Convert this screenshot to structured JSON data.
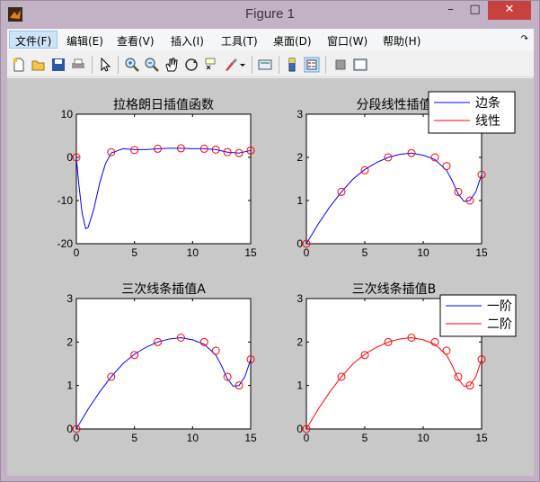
{
  "window": {
    "title": "Figure 1"
  },
  "menu": {
    "items": [
      {
        "label": "文件(F)",
        "active": true
      },
      {
        "label": "编辑(E)"
      },
      {
        "label": "查看(V)"
      },
      {
        "label": "插入(I)"
      },
      {
        "label": "工具(T)"
      },
      {
        "label": "桌面(D)"
      },
      {
        "label": "窗口(W)"
      },
      {
        "label": "帮助(H)"
      }
    ],
    "overflow_icon": "chevron-icon"
  },
  "toolbar": {
    "icons": [
      "new-figure-icon",
      "open-file-icon",
      "save-icon",
      "print-icon",
      "select-arrow-icon",
      "zoom-in-icon",
      "zoom-out-icon",
      "pan-hand-icon",
      "rotate-3d-icon",
      "data-cursor-icon",
      "brush-icon",
      "brush-dropdown-icon",
      "link-plot-icon",
      "colorbar-icon",
      "legend-icon",
      "hide-plot-tools-icon",
      "show-plot-tools-icon"
    ]
  },
  "colors": {
    "blue": "#0000ff",
    "red": "#ff0000",
    "figure_bg": "#c8c8c8"
  },
  "chart_data": [
    {
      "type": "line",
      "title": "拉格朗日插值函数",
      "xlim": [
        0,
        15
      ],
      "ylim": [
        -20,
        10
      ],
      "xticks": [
        0,
        5,
        10,
        15
      ],
      "yticks": [
        -20,
        -10,
        0,
        10
      ],
      "series": [
        {
          "color": "blue",
          "x": [
            0,
            0.2,
            0.5,
            0.8,
            1.0,
            1.5,
            2.0,
            2.5,
            3,
            4,
            5,
            6,
            7,
            8,
            9,
            10,
            11,
            12,
            13,
            14,
            15
          ],
          "y": [
            0,
            -6,
            -13,
            -16.5,
            -16.3,
            -12,
            -6,
            -1.5,
            1,
            2,
            1.8,
            1.8,
            2,
            2.1,
            2.1,
            2,
            2,
            1.8,
            1.2,
            1,
            1.6
          ]
        },
        {
          "color": "red",
          "marker": "circle",
          "x": [
            0,
            3,
            5,
            7,
            9,
            11,
            12,
            13,
            14,
            15
          ],
          "y": [
            0,
            1.2,
            1.7,
            2.0,
            2.1,
            2.0,
            1.8,
            1.2,
            1.0,
            1.6
          ]
        }
      ]
    },
    {
      "type": "line",
      "title": "分段线性插值",
      "xlim": [
        0,
        15
      ],
      "ylim": [
        0,
        3
      ],
      "xticks": [
        0,
        5,
        10,
        15
      ],
      "yticks": [
        0,
        1,
        2,
        3
      ],
      "legend": {
        "entries": [
          "边条",
          "线性"
        ],
        "colors": [
          "blue",
          "red"
        ],
        "placement": "top-right"
      },
      "series": [
        {
          "color": "blue",
          "x": [
            0,
            1,
            2,
            3,
            4,
            5,
            6,
            7,
            8,
            9,
            10,
            11,
            12,
            12.5,
            13,
            13.5,
            14,
            14.5,
            15
          ],
          "y": [
            0,
            0.45,
            0.85,
            1.2,
            1.5,
            1.72,
            1.88,
            2.0,
            2.07,
            2.1,
            2.05,
            1.95,
            1.7,
            1.45,
            1.15,
            0.98,
            1.0,
            1.2,
            1.6
          ]
        },
        {
          "color": "red",
          "marker": "circle",
          "x": [
            0,
            3,
            5,
            7,
            9,
            11,
            12,
            13,
            14,
            15
          ],
          "y": [
            0,
            1.2,
            1.7,
            2.0,
            2.1,
            2.0,
            1.8,
            1.2,
            1.0,
            1.6
          ]
        }
      ]
    },
    {
      "type": "line",
      "title": "三次线条插值A",
      "xlim": [
        0,
        15
      ],
      "ylim": [
        0,
        3
      ],
      "xticks": [
        0,
        5,
        10,
        15
      ],
      "yticks": [
        0,
        1,
        2,
        3
      ],
      "series": [
        {
          "color": "blue",
          "x": [
            0,
            1,
            2,
            3,
            4,
            5,
            6,
            7,
            8,
            9,
            10,
            11,
            12,
            12.5,
            13,
            13.5,
            14,
            14.5,
            15
          ],
          "y": [
            0,
            0.45,
            0.85,
            1.2,
            1.5,
            1.72,
            1.88,
            2.0,
            2.07,
            2.1,
            2.05,
            1.95,
            1.7,
            1.45,
            1.15,
            0.98,
            1.0,
            1.2,
            1.6
          ]
        },
        {
          "color": "red",
          "marker": "circle",
          "x": [
            0,
            3,
            5,
            7,
            9,
            11,
            12,
            13,
            14,
            15
          ],
          "y": [
            0,
            1.2,
            1.7,
            2.0,
            2.1,
            2.0,
            1.8,
            1.2,
            1.0,
            1.6
          ]
        }
      ]
    },
    {
      "type": "line",
      "title": "三次线条插值B",
      "xlim": [
        0,
        15
      ],
      "ylim": [
        0,
        3
      ],
      "xticks": [
        0,
        5,
        10,
        15
      ],
      "yticks": [
        0,
        1,
        2,
        3
      ],
      "legend": {
        "entries": [
          "一阶",
          "二阶"
        ],
        "colors": [
          "blue",
          "red"
        ],
        "placement": "top-right"
      },
      "series": [
        {
          "color": "red",
          "x": [
            0,
            1,
            2,
            3,
            4,
            5,
            6,
            7,
            8,
            9,
            10,
            11,
            12,
            12.5,
            13,
            13.5,
            14,
            14.5,
            15
          ],
          "y": [
            0,
            0.45,
            0.85,
            1.2,
            1.5,
            1.72,
            1.88,
            2.0,
            2.07,
            2.1,
            2.05,
            1.95,
            1.7,
            1.45,
            1.15,
            0.98,
            1.0,
            1.2,
            1.6
          ]
        },
        {
          "color": "red",
          "marker": "circle",
          "x": [
            0,
            3,
            5,
            7,
            9,
            11,
            12,
            13,
            14,
            15
          ],
          "y": [
            0,
            1.2,
            1.7,
            2.0,
            2.1,
            2.0,
            1.8,
            1.2,
            1.0,
            1.6
          ]
        }
      ]
    }
  ]
}
